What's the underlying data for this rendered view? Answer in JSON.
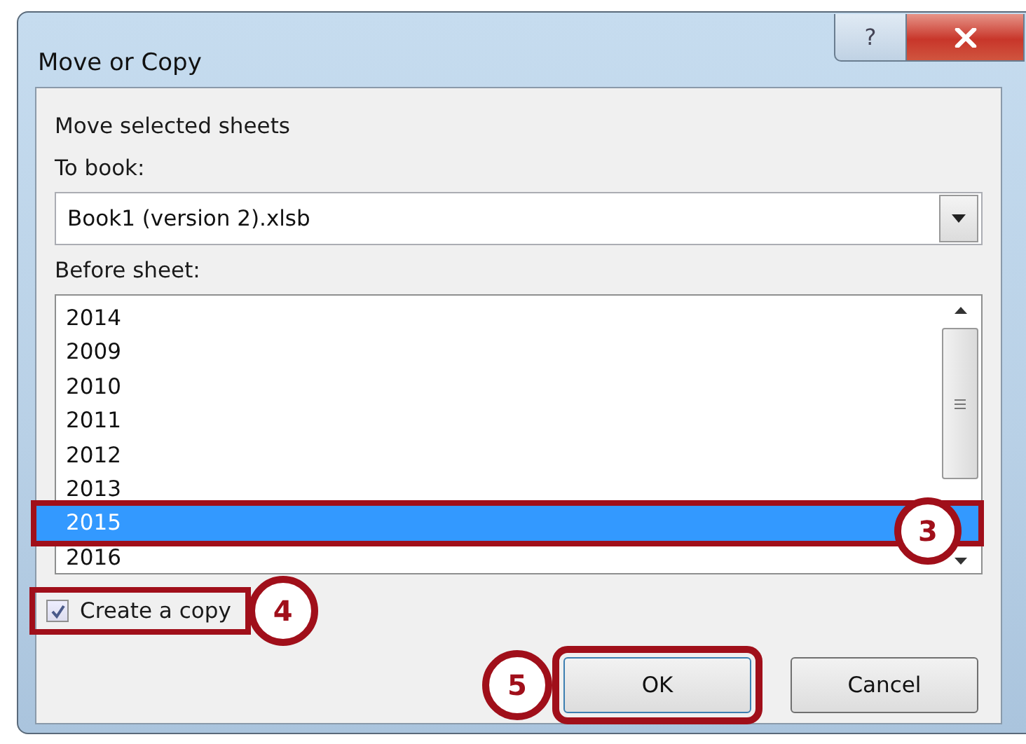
{
  "window": {
    "title": "Move or Copy",
    "caption_buttons": [
      {
        "kind": "help",
        "label": "?"
      },
      {
        "kind": "close"
      }
    ]
  },
  "heading": "Move selected sheets",
  "to_book": {
    "label": "To book:",
    "value": "Book1 (version 2).xlsb"
  },
  "before_sheet": {
    "label": "Before sheet:",
    "items": [
      {
        "label": "2014",
        "selected": false,
        "highlighted": false
      },
      {
        "label": "2009",
        "selected": false,
        "highlighted": false
      },
      {
        "label": "2010",
        "selected": false,
        "highlighted": false
      },
      {
        "label": "2011",
        "selected": false,
        "highlighted": false
      },
      {
        "label": "2012",
        "selected": false,
        "highlighted": false
      },
      {
        "label": "2013",
        "selected": false,
        "highlighted": false
      },
      {
        "label": "2015",
        "selected": true,
        "highlighted": true,
        "callout": "3"
      },
      {
        "label": "2016",
        "selected": false,
        "highlighted": false
      }
    ]
  },
  "create_copy": {
    "label": "Create a copy",
    "checked": true,
    "highlighted": true,
    "callout": "4"
  },
  "buttons": [
    {
      "label": "OK",
      "highlighted": true,
      "callout": "5"
    },
    {
      "label": "Cancel",
      "highlighted": false
    }
  ]
}
